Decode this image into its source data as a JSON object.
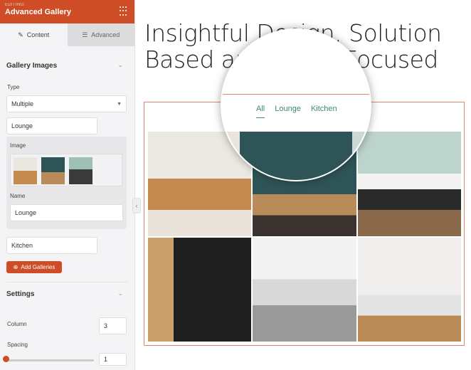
{
  "sidebar": {
    "editing_label": "EDITING:",
    "title": "Advanced Gallery",
    "tabs": [
      {
        "label": "Content",
        "icon": "pencil-icon",
        "active": true
      },
      {
        "label": "Advanced",
        "icon": "sliders-icon",
        "active": false
      }
    ],
    "gallery_section": "Gallery Images",
    "type_label": "Type",
    "type_value": "Multiple",
    "gallery1_name": "Lounge",
    "image_label": "Image",
    "name_label": "Name",
    "name_value": "Lounge",
    "gallery2_name": "Kitchen",
    "add_button": "Add Galleries",
    "settings_section": "Settings",
    "column_label": "Column",
    "column_value": "3",
    "spacing_label": "Spacing",
    "spacing_value": "1",
    "spacing_slider": 1
  },
  "main": {
    "title_line1": "Insightful Design, Solution",
    "title_line2": "Based and Client Focused",
    "filters": [
      {
        "label": "All",
        "active": true
      },
      {
        "label": "Lounge"
      },
      {
        "label": "Kitchen"
      }
    ]
  },
  "colors": {
    "accent": "#cf4d26",
    "filter": "#3b8a74"
  }
}
